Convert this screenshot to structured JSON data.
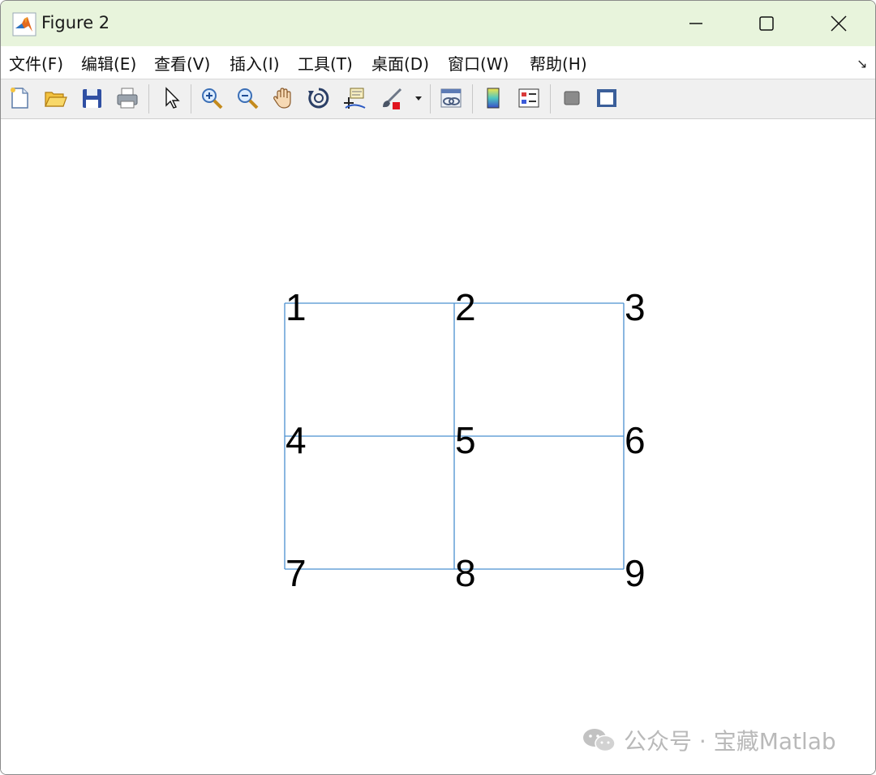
{
  "window": {
    "title": "Figure 2",
    "icon": "matlab-logo-icon",
    "controls": [
      "minimize-icon",
      "maximize-icon",
      "close-icon"
    ]
  },
  "menu": {
    "items": [
      "文件(F)",
      "编辑(E)",
      "查看(V)",
      "插入(I)",
      "工具(T)",
      "桌面(D)",
      "窗口(W)",
      "帮助(H)"
    ],
    "expand_icon": "dock-arrow-icon"
  },
  "toolbar": {
    "buttons": [
      "new-figure-icon",
      "open-file-icon",
      "save-icon",
      "print-icon",
      "edit-plot-arrow-icon",
      "zoom-in-icon",
      "zoom-out-icon",
      "pan-hand-icon",
      "rotate-3d-icon",
      "data-cursor-icon",
      "brush-icon",
      "link-plot-icon",
      "colorbar-icon",
      "legend-icon",
      "hide-plot-tools-icon",
      "show-plot-tools-icon"
    ]
  },
  "graph": {
    "edge_color": "#4a90d0",
    "nodes": [
      {
        "label": "1",
        "x": 0,
        "y": 2
      },
      {
        "label": "2",
        "x": 1,
        "y": 2
      },
      {
        "label": "3",
        "x": 2,
        "y": 2
      },
      {
        "label": "4",
        "x": 0,
        "y": 1
      },
      {
        "label": "5",
        "x": 1,
        "y": 1
      },
      {
        "label": "6",
        "x": 2,
        "y": 1
      },
      {
        "label": "7",
        "x": 0,
        "y": 0
      },
      {
        "label": "8",
        "x": 1,
        "y": 0
      },
      {
        "label": "9",
        "x": 2,
        "y": 0
      }
    ],
    "edges": [
      [
        1,
        2
      ],
      [
        2,
        3
      ],
      [
        4,
        5
      ],
      [
        5,
        6
      ],
      [
        7,
        8
      ],
      [
        8,
        9
      ],
      [
        1,
        4
      ],
      [
        4,
        7
      ],
      [
        2,
        5
      ],
      [
        5,
        8
      ],
      [
        3,
        6
      ],
      [
        6,
        9
      ]
    ]
  },
  "watermark": {
    "text": "公众号 · 宝藏Matlab",
    "icon": "wechat-icon"
  }
}
